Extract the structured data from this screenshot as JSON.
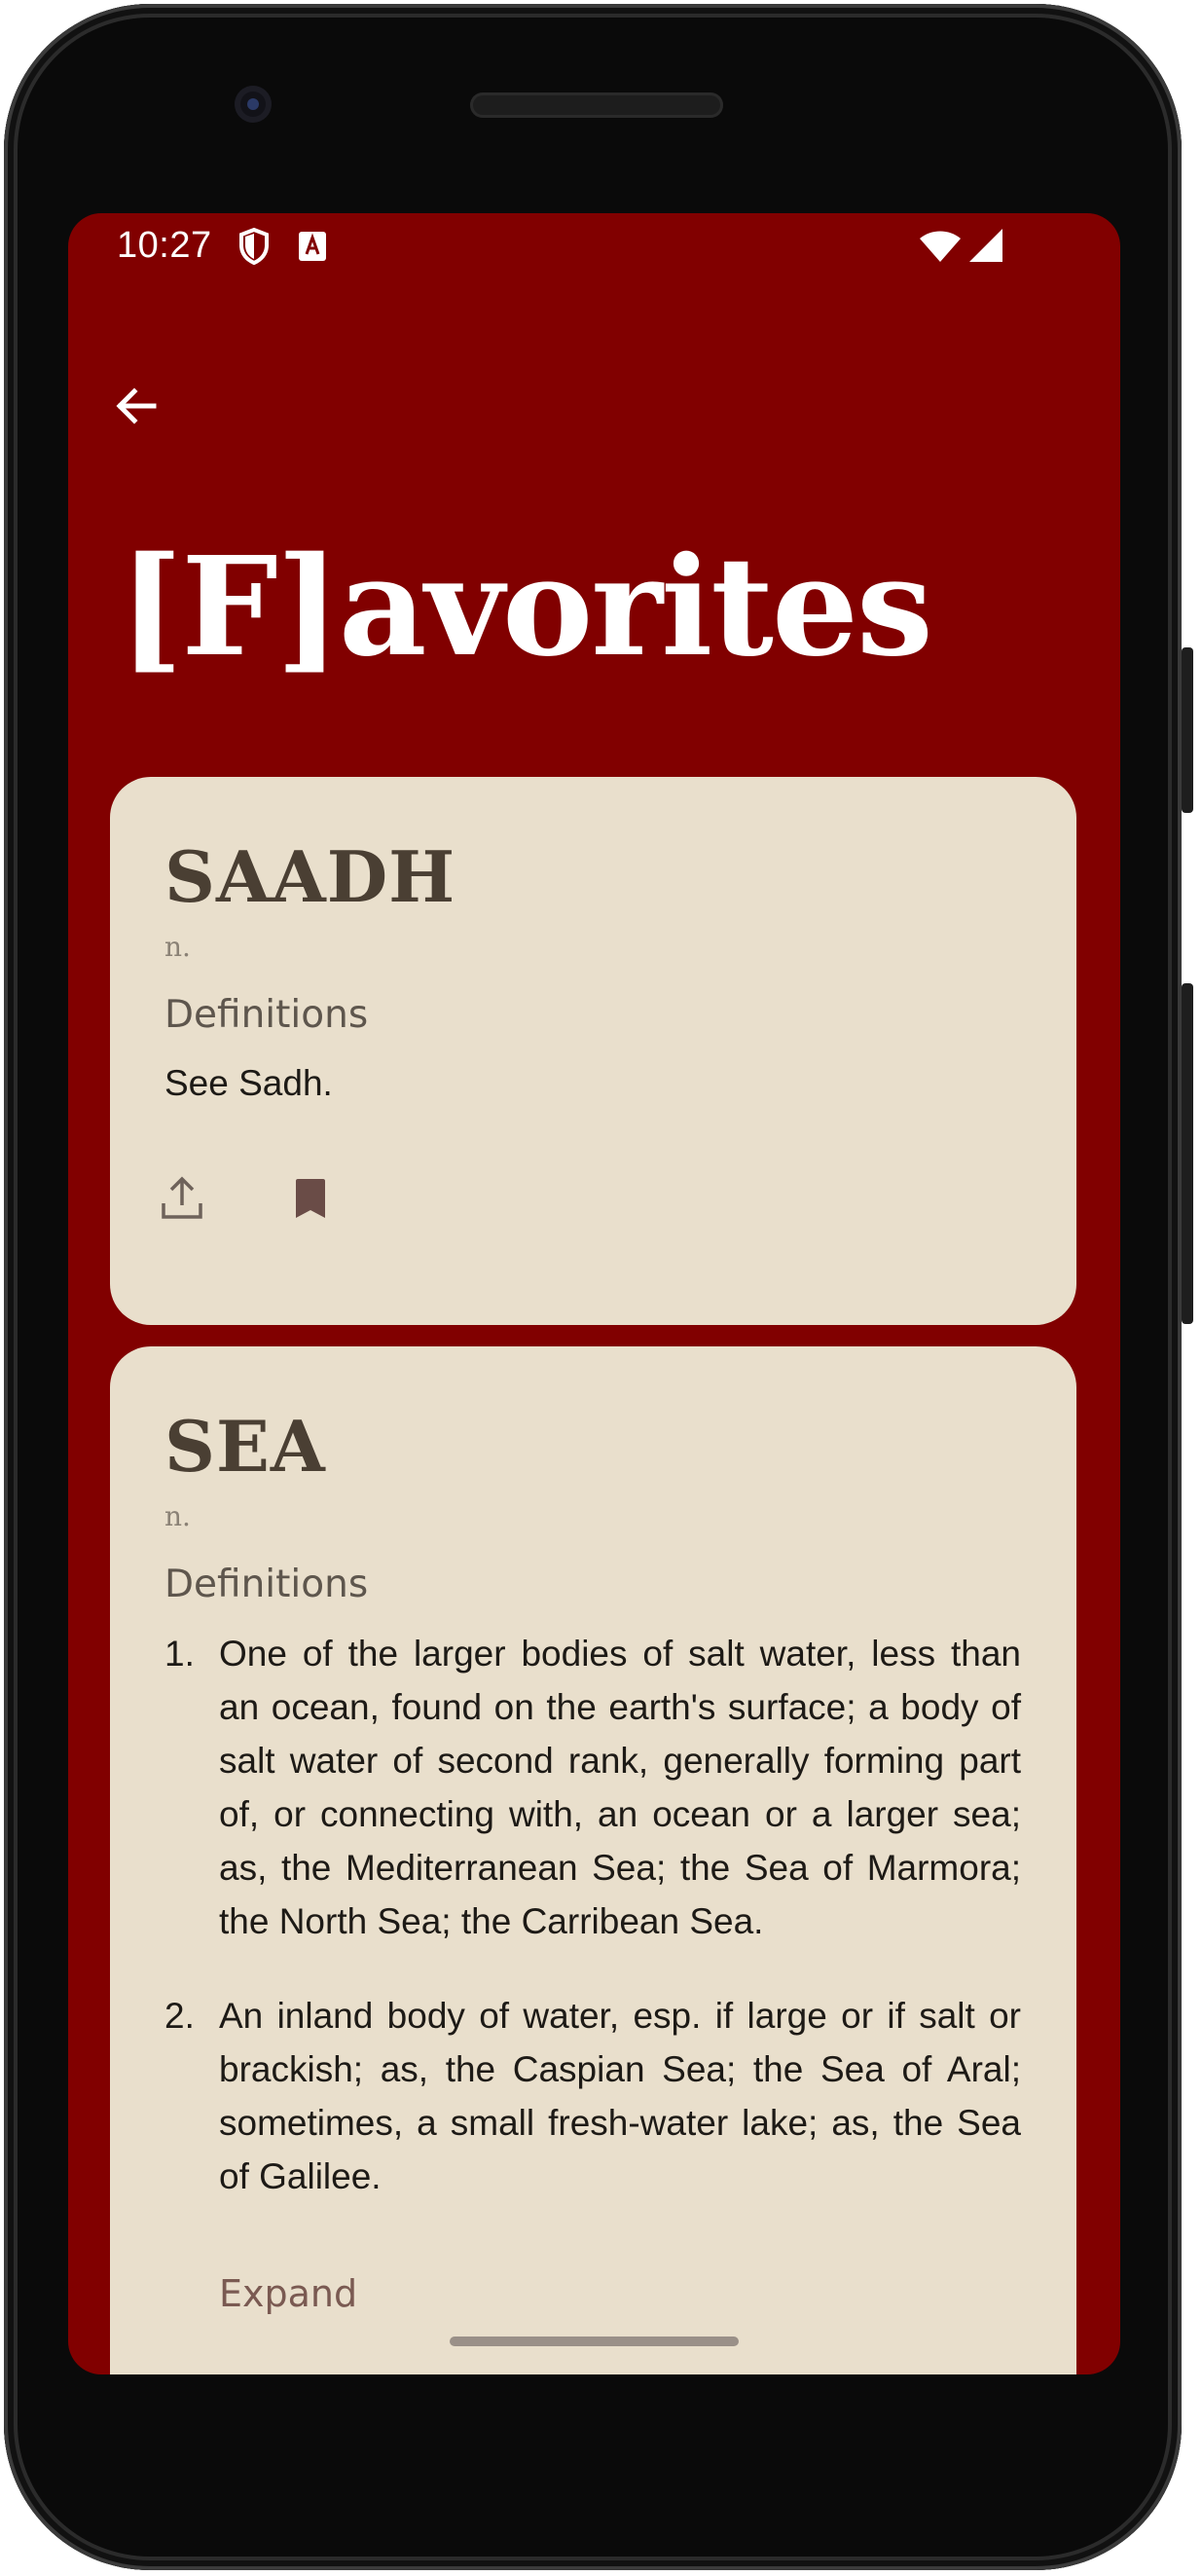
{
  "status_bar": {
    "time": "10:27",
    "icons": [
      "shield-icon",
      "keyboard-a-icon",
      "wifi-icon",
      "signal-icon"
    ]
  },
  "app_bar": {
    "back_icon": "arrow-back-icon"
  },
  "page": {
    "title": "[F]avorites"
  },
  "colors": {
    "background": "#810000",
    "card": "#e9dfcc",
    "word": "#4a3f33",
    "accent": "#7a5a52"
  },
  "cards": [
    {
      "word": "SAADH",
      "part_of_speech": "n.",
      "definitions_heading": "Definitions",
      "definition": "See Sadh.",
      "actions": [
        "share-icon",
        "bookmark-icon"
      ]
    },
    {
      "word": "SEA",
      "part_of_speech": "n.",
      "definitions_heading": "Definitions",
      "definitions": [
        {
          "number": "1.",
          "text": "One of the larger bodies of salt water, less than an ocean, found on the earth's surface; a body of salt water of second rank, generally forming part of, or connecting with, an ocean or a larger sea; as, the Mediterranean Sea; the Sea of Marmora; the North Sea; the Carribean Sea."
        },
        {
          "number": "2.",
          "text": "An inland body of water, esp. if large or if salt or brackish; as, the Caspian Sea; the Sea of Aral; sometimes, a small fresh-water lake; as, the Sea of Galilee."
        }
      ],
      "expand_label": "Expand"
    }
  ]
}
